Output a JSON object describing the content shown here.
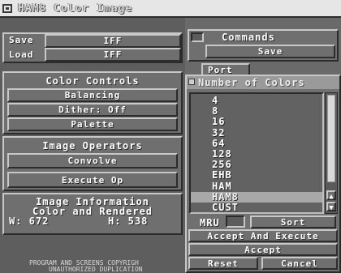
{
  "window": {
    "title": "HAM8 Color Image"
  },
  "file": {
    "save_label": "Save",
    "load_label": "Load",
    "save_format": "IFF",
    "load_format": "IFF"
  },
  "color_controls": {
    "header": "Color Controls",
    "balancing": "Balancing",
    "dither": "Dither: Off",
    "palette": "Palette"
  },
  "image_operators": {
    "header": "Image Operators",
    "convolve": "Convolve",
    "execute": "Execute Op"
  },
  "image_info": {
    "header": "Image Information",
    "line2": "Color and Rendered",
    "width": "W: 672",
    "height": "H: 538"
  },
  "copyright": {
    "line1": "PROGRAM AND SCREENS COPYRIGH",
    "line2": "UNAUTHORIZED DUPLICATION"
  },
  "commands": {
    "header": "Commands",
    "save": "Save",
    "port": "Port"
  },
  "number_of_colors": {
    "title": "Number of Colors",
    "options": [
      "4",
      "8",
      "16",
      "32",
      "64",
      "128",
      "256",
      "EHB",
      "HAM",
      "HAM8",
      "CUST"
    ],
    "selected": "HAM8",
    "mru_label": "MRU",
    "sort": "Sort",
    "accept_and_execute": "Accept And Execute",
    "accept": "Accept",
    "reset": "Reset",
    "cancel": "Cancel"
  }
}
